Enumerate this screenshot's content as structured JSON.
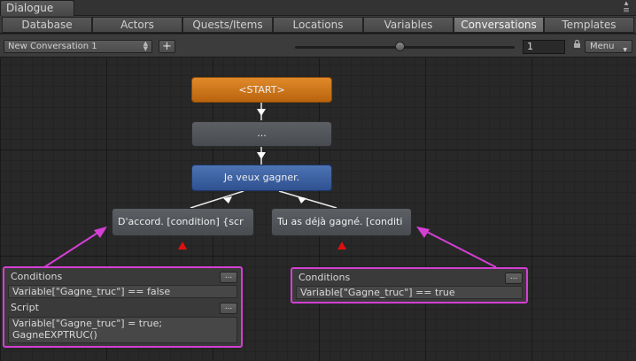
{
  "window": {
    "title": "Dialogue"
  },
  "tabs": [
    {
      "label": "Database",
      "active": false
    },
    {
      "label": "Actors",
      "active": false
    },
    {
      "label": "Quests/Items",
      "active": false
    },
    {
      "label": "Locations",
      "active": false
    },
    {
      "label": "Variables",
      "active": false
    },
    {
      "label": "Conversations",
      "active": true
    },
    {
      "label": "Templates",
      "active": false
    }
  ],
  "toolbar": {
    "conversation": "New Conversation 1",
    "add_label": "+",
    "zoom_value": "1",
    "menu_label": "Menu"
  },
  "nodes": {
    "start": "<START>",
    "empty": "...",
    "npc": "Je veux gagner.",
    "response_1": "D'accord. [condition] {scr",
    "response_2": "Tu as déjà gagné. [conditi"
  },
  "panel_1": {
    "conditions_label": "Conditions",
    "conditions_value": "Variable[\"Gagne_truc\"] == false",
    "script_label": "Script",
    "script_line_1": "Variable[\"Gagne_truc\"] = true;",
    "script_line_2": "GagneEXPTRUC()",
    "more_label": "..."
  },
  "panel_2": {
    "conditions_label": "Conditions",
    "conditions_value": "Variable[\"Gagne_truc\"] == true",
    "more_label": "..."
  },
  "colors": {
    "start_node": "#c8731a",
    "npc_node": "#3d62a3",
    "highlight": "#d43fd4",
    "marker": "#e01010"
  }
}
